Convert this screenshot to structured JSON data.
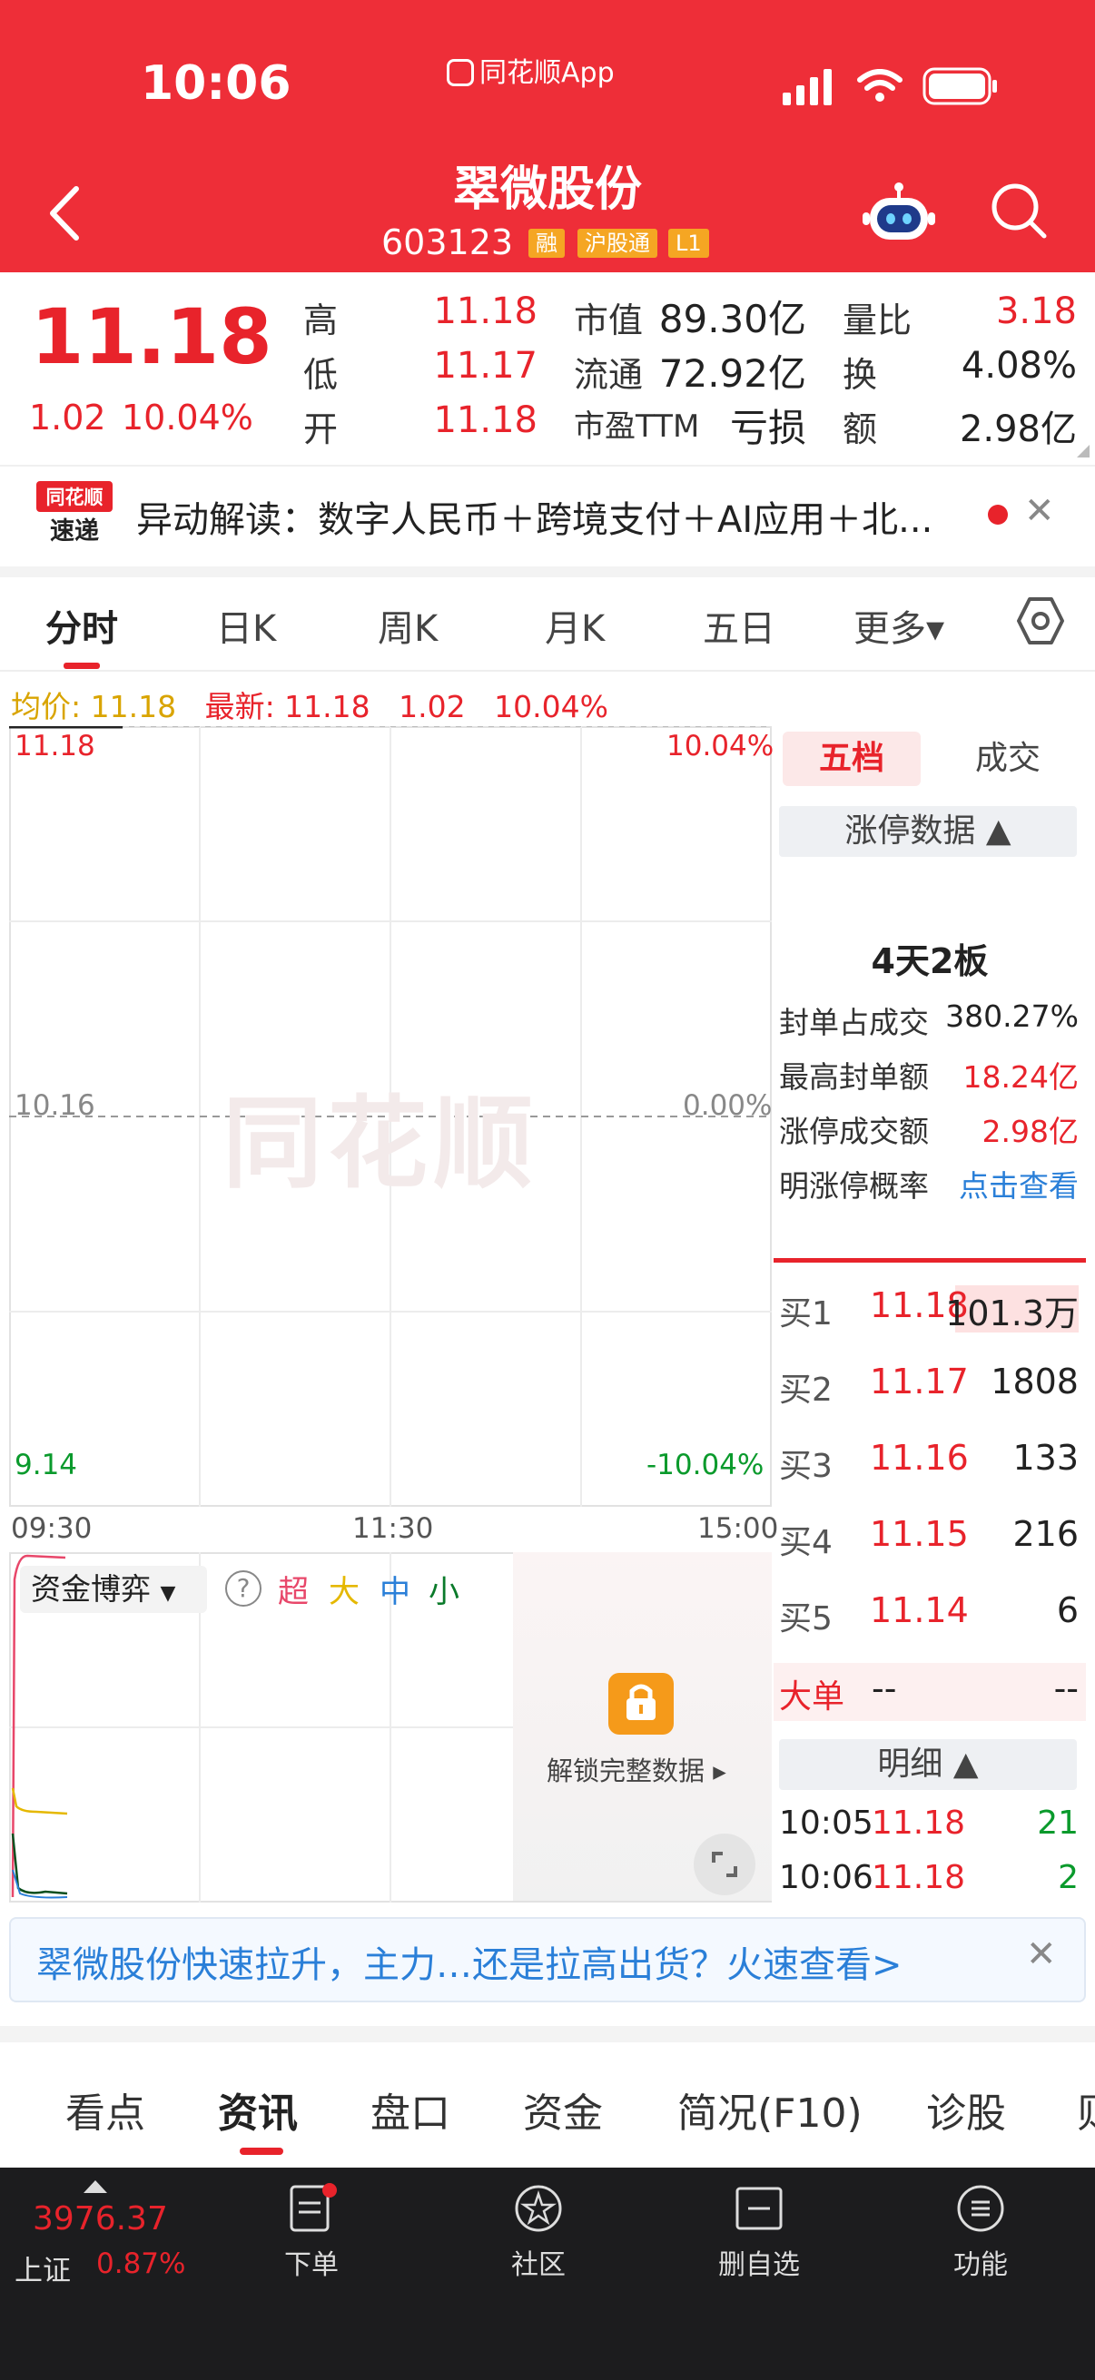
{
  "status_bar": {
    "time": "10:06",
    "app": "同花顺App"
  },
  "header": {
    "stock_name": "翠微股份",
    "stock_code": "603123",
    "tags": [
      "融",
      "沪股通",
      "L1"
    ]
  },
  "quote": {
    "price": "11.18",
    "change": "1.02",
    "change_pct": "10.04%",
    "rows": [
      {
        "k1": "高",
        "v1": "11.18",
        "k2": "市值",
        "v2": "89.30亿",
        "k3": "量比",
        "v3": "3.18"
      },
      {
        "k1": "低",
        "v1": "11.17",
        "k2": "流通",
        "v2": "72.92亿",
        "k3": "换",
        "v3": "4.08%"
      },
      {
        "k1": "开",
        "v1": "11.18",
        "k2": "市盈TTM",
        "v2": "亏损",
        "k3": "额",
        "v3": "2.98亿"
      }
    ]
  },
  "alert": {
    "logo_top": "同花顺",
    "logo_bottom": "速递",
    "text": "异动解读：数字人民币＋跨境支付＋AI应用＋北..."
  },
  "chart_tabs": [
    "分时",
    "日K",
    "周K",
    "月K",
    "五日",
    "更多▾"
  ],
  "info_line": {
    "avg_label": "均价: 11.18",
    "latest_label": "最新: 11.18",
    "change": "1.02",
    "pct": "10.04%"
  },
  "chart": {
    "top_price": "11.18",
    "top_pct": "10.04%",
    "mid_price": "10.16",
    "mid_pct": "0.00%",
    "bottom_price": "9.14",
    "bottom_pct": "-10.04%",
    "times": [
      "09:30",
      "11:30",
      "15:00"
    ],
    "watermark": "同花顺"
  },
  "chart_data": {
    "type": "line",
    "x": [
      "09:30",
      "11:30",
      "15:00"
    ],
    "ylim": [
      9.14,
      11.18
    ],
    "series": [
      {
        "values": [
          11.18,
          11.18
        ]
      }
    ]
  },
  "funds": {
    "select_label": "资金博弈",
    "legend": [
      {
        "label": "超",
        "color": "#e8476a"
      },
      {
        "label": "大",
        "color": "#e5b800"
      },
      {
        "label": "中",
        "color": "#2a7fd8"
      },
      {
        "label": "小",
        "color": "#0a7a2a"
      }
    ],
    "unlock_text": "解锁完整数据 ▸"
  },
  "right_panel": {
    "tab_active": "五档",
    "tab_other": "成交",
    "limit_header": "涨停数据 ▲",
    "limit_days": "4天2板",
    "limit_rows": [
      {
        "label": "封单占成交",
        "value": "380.27%",
        "color": "#222"
      },
      {
        "label": "最高封单额",
        "value": "18.24亿",
        "color": "#e8232b"
      },
      {
        "label": "涨停成交额",
        "value": "2.98亿",
        "color": "#e8232b"
      },
      {
        "label": "明涨停概率",
        "value": "点击查看",
        "color": "#2a7fd8"
      }
    ],
    "bids": [
      {
        "label": "买1",
        "price": "11.18",
        "volume": "101.3万"
      },
      {
        "label": "买2",
        "price": "11.17",
        "volume": "1808"
      },
      {
        "label": "买3",
        "price": "11.16",
        "volume": "133"
      },
      {
        "label": "买4",
        "price": "11.15",
        "volume": "216"
      },
      {
        "label": "买5",
        "price": "11.14",
        "volume": "6"
      }
    ],
    "big_order": {
      "label": "大单",
      "v1": "--",
      "v2": "--"
    },
    "detail_header": "明细 ▲",
    "trades": [
      {
        "time": "10:05",
        "price": "11.18",
        "volume": "21"
      },
      {
        "time": "10:06",
        "price": "11.18",
        "volume": "2"
      }
    ]
  },
  "promo": {
    "text": "翠微股份快速拉升，主力…还是拉高出货？火速查看>"
  },
  "bottom_tabs": [
    "看点",
    "资讯",
    "盘口",
    "资金",
    "简况(F10)",
    "诊股",
    "则"
  ],
  "nav": {
    "index_value": "3976.37",
    "index_name": "上证",
    "index_pct": "0.87%",
    "items": [
      "下单",
      "社区",
      "删自选",
      "功能"
    ]
  }
}
